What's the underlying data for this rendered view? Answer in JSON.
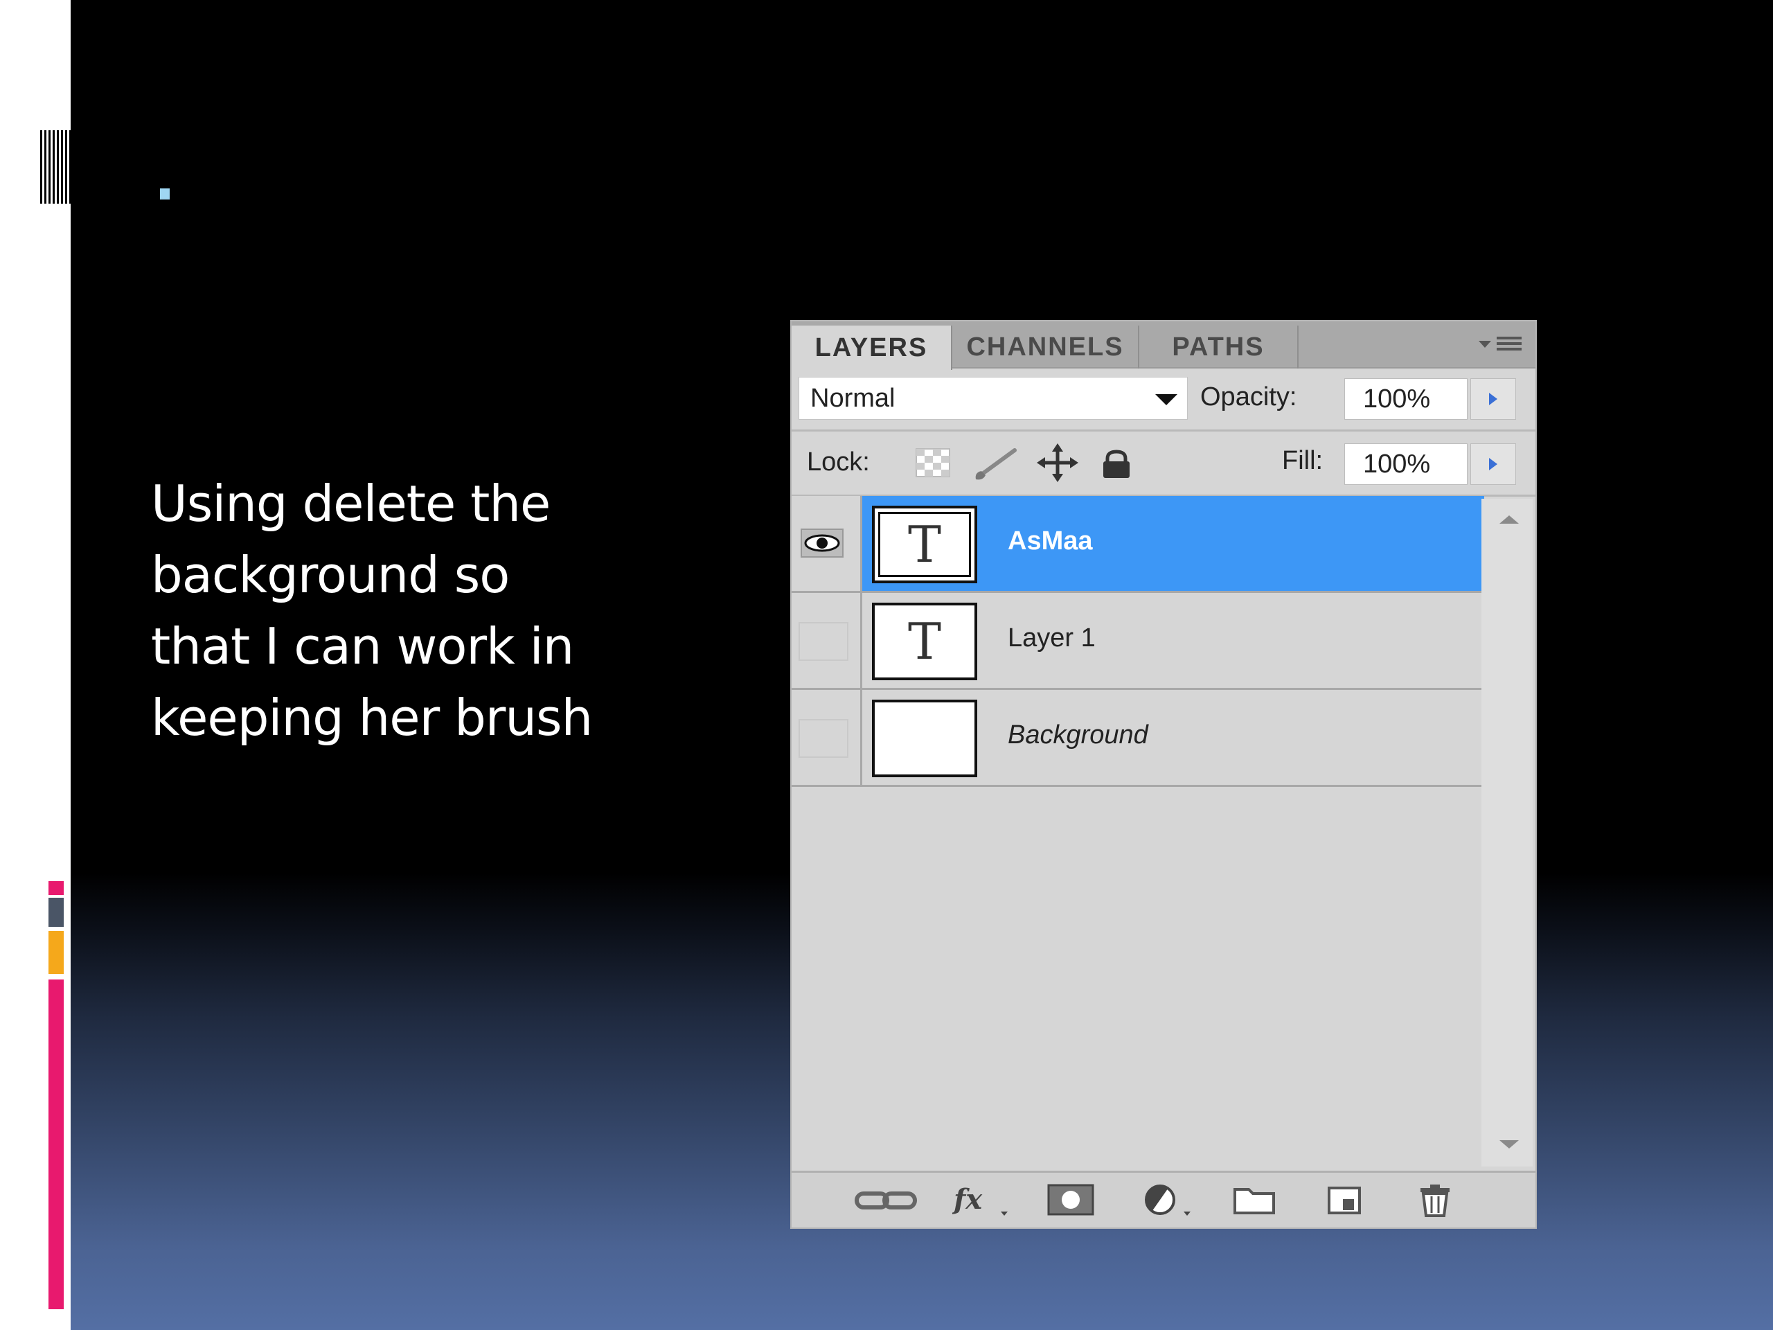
{
  "slide": {
    "body_text": "Using delete the\nbackground so\nthat I can work in\nkeeping her brush"
  },
  "colors": {
    "accent_pink": "#e8196e",
    "accent_orange": "#f5a81b",
    "accent_gray": "#4a5566",
    "bullet": "#9fd6f3",
    "selection_blue": "#3d97f6"
  },
  "panel": {
    "tabs": [
      {
        "label": "LAYERS",
        "active": true
      },
      {
        "label": "CHANNELS",
        "active": false
      },
      {
        "label": "PATHS",
        "active": false
      }
    ],
    "blend_mode": "Normal",
    "opacity_label": "Opacity:",
    "opacity_value": "100%",
    "lock_label": "Lock:",
    "fill_label": "Fill:",
    "fill_value": "100%",
    "layers": [
      {
        "name": "AsMaa",
        "thumb": "T",
        "selected": true,
        "visible": true,
        "locked": false
      },
      {
        "name": "Layer 1",
        "thumb": "T",
        "selected": false,
        "visible": false,
        "locked": false
      },
      {
        "name": "Background",
        "thumb": "",
        "selected": false,
        "visible": false,
        "locked": true
      }
    ],
    "bottom_icons": [
      "link-layers-icon",
      "fx-icon",
      "mask-icon",
      "adjustment-icon",
      "folder-icon",
      "new-layer-icon",
      "trash-icon"
    ]
  }
}
